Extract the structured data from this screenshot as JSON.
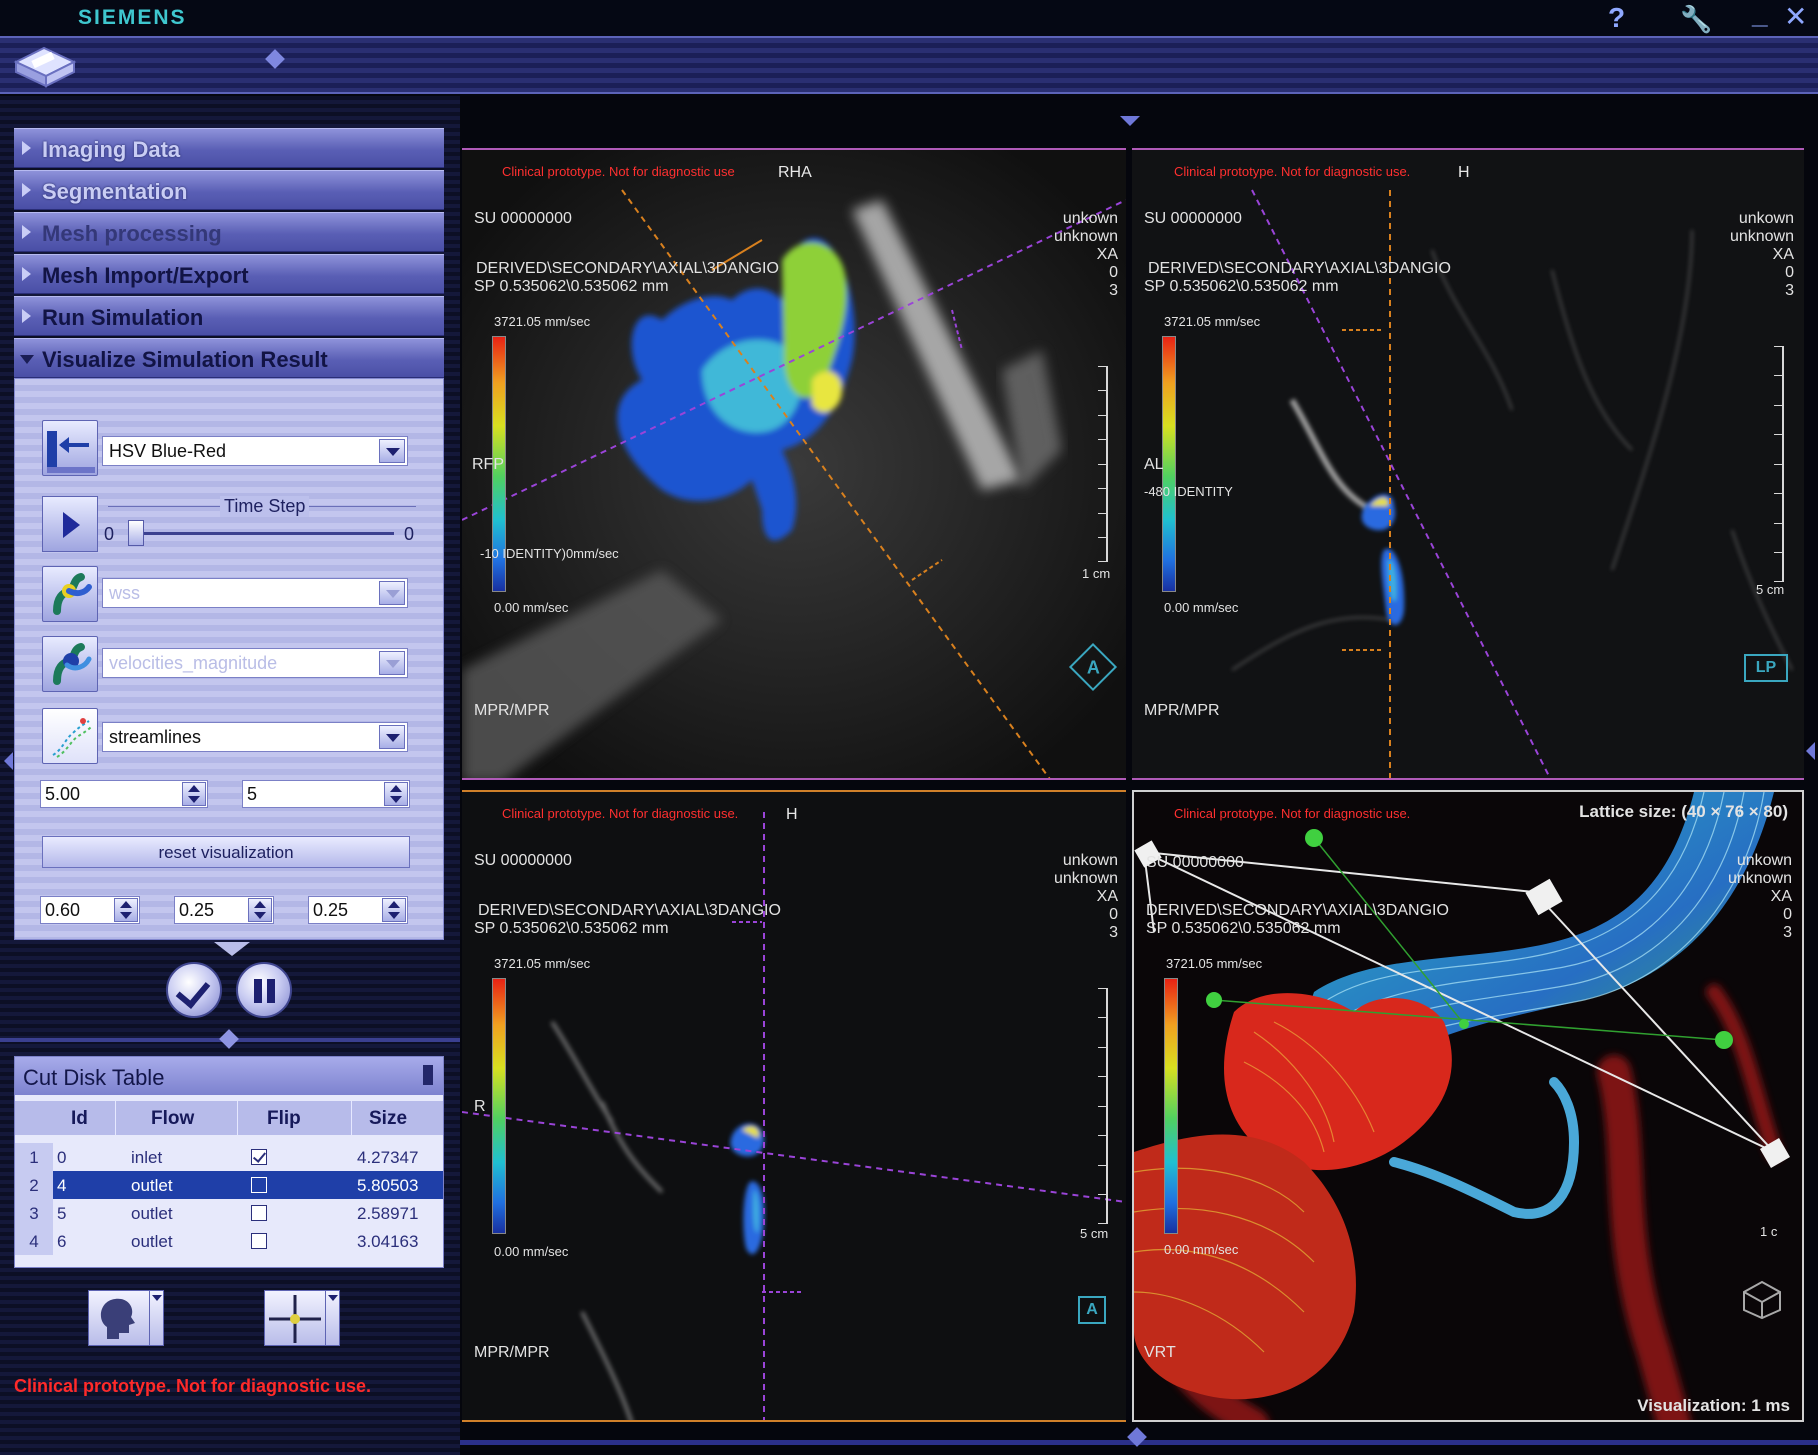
{
  "window": {
    "brand": "SIEMENS",
    "help_label": "?",
    "tools_label": "🔧",
    "minimize_label": "_",
    "close_label": "✕"
  },
  "left_panel": {
    "accordion": [
      {
        "label": "Imaging Data",
        "state": "collapsed"
      },
      {
        "label": "Segmentation",
        "state": "collapsed"
      },
      {
        "label": "Mesh processing",
        "state": "collapsed"
      },
      {
        "label": "Mesh Import/Export",
        "state": "collapsed"
      },
      {
        "label": "Run Simulation",
        "state": "collapsed"
      },
      {
        "label": "Visualize Simulation Result",
        "state": "expanded"
      }
    ],
    "visualize": {
      "colormap": "HSV Blue-Red",
      "time_step_label": "Time Step",
      "time_step_min": "0",
      "time_step_max": "0",
      "wss_select": "wss",
      "velocity_select": "velocities_magnitude",
      "render_mode": "streamlines",
      "spin_a": "5.00",
      "spin_b": "5",
      "reset_label": "reset visualization",
      "spin_c": "0.60",
      "spin_d": "0.25",
      "spin_e": "0.25"
    },
    "cut_disk_table": {
      "title": "Cut Disk Table",
      "columns": [
        "Id",
        "Flow",
        "Flip",
        "Size"
      ],
      "rows": [
        {
          "row": "1",
          "id": "0",
          "flow": "inlet",
          "flip": true,
          "size": "4.27347",
          "selected": false
        },
        {
          "row": "2",
          "id": "4",
          "flow": "outlet",
          "flip": false,
          "size": "5.80503",
          "selected": true
        },
        {
          "row": "3",
          "id": "5",
          "flow": "outlet",
          "flip": false,
          "size": "2.58971",
          "selected": false
        },
        {
          "row": "4",
          "id": "6",
          "flow": "outlet",
          "flip": false,
          "size": "3.04163",
          "selected": false
        }
      ]
    },
    "warning": "Clinical prototype. Not for diagnostic use."
  },
  "viewports": {
    "tl": {
      "warning": "Clinical prototype. Not for diagnostic use",
      "orient": "RHA",
      "su": "SU 00000000",
      "derived": "DERIVED\\SECONDARY\\AXIAL\\3DANGIO",
      "sp": "SP 0.535062\\0.535062 mm",
      "right1": "unkown",
      "right2": "unknown",
      "right3": "XA",
      "right4": "0",
      "right5": "3",
      "cb_top": "3721.05 mm/sec",
      "cb_mid": "-10 IDENTITY)0mm/sec",
      "cb_bottom": "0.00 mm/sec",
      "side_label": "RFP",
      "scale": "1 cm",
      "mode": "MPR/MPR",
      "cube": "A"
    },
    "tr": {
      "warning": "Clinical prototype. Not for diagnostic use.",
      "orient": "H",
      "su": "SU 00000000",
      "derived": "DERIVED\\SECONDARY\\AXIAL\\3DANGIO",
      "sp": "SP 0.535062\\0.535062 mm",
      "right1": "unkown",
      "right2": "unknown",
      "right3": "XA",
      "right4": "0",
      "right5": "3",
      "cb_top": "3721.05 mm/sec",
      "cb_mid": "-480 IDENTITY",
      "cb_bottom": "0.00 mm/sec",
      "side_label": "AL",
      "scale": "5 cm",
      "mode": "MPR/MPR",
      "cube": "LP"
    },
    "bl": {
      "warning": "Clinical prototype. Not for diagnostic use.",
      "orient": "H",
      "su": "SU 00000000",
      "derived": "DERIVED\\SECONDARY\\AXIAL\\3DANGIO",
      "sp": "SP 0.535062\\0.535062 mm",
      "right1": "unkown",
      "right2": "unknown",
      "right3": "XA",
      "right4": "0",
      "right5": "3",
      "cb_top": "3721.05 mm/sec",
      "cb_bottom": "0.00 mm/sec",
      "side_label": "R",
      "scale": "5 cm",
      "mode": "MPR/MPR",
      "cube": "A"
    },
    "br": {
      "warning": "Clinical prototype. Not for diagnostic use.",
      "lattice": "Lattice size: (40 × 76 × 80)",
      "su": "SU 00000000",
      "derived": "DERIVED\\SECONDARY\\AXIAL\\3DANGIO",
      "sp": "SP 0.535062\\0.535062 mm",
      "right1": "unkown",
      "right2": "unknown",
      "right3": "XA",
      "right4": "0",
      "right5": "3",
      "cb_top": "3721.05 mm/sec",
      "cb_bottom": "0.00 mm/sec",
      "scale": "1 c",
      "mode": "VRT",
      "vis_time": "Visualization: 1 ms"
    }
  }
}
